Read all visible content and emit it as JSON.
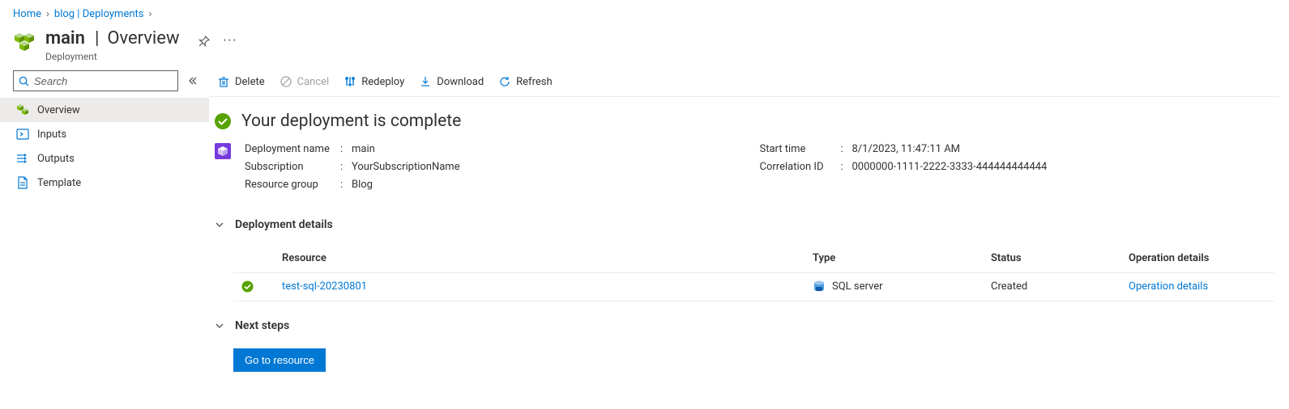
{
  "breadcrumb": {
    "items": [
      "Home",
      "blog | Deployments"
    ]
  },
  "header": {
    "name": "main",
    "section": "Overview",
    "subtitle": "Deployment"
  },
  "sidebar": {
    "search_placeholder": "Search",
    "items": [
      {
        "label": "Overview",
        "icon": "cubes",
        "active": true
      },
      {
        "label": "Inputs",
        "icon": "inputs",
        "active": false
      },
      {
        "label": "Outputs",
        "icon": "outputs",
        "active": false
      },
      {
        "label": "Template",
        "icon": "template",
        "active": false
      }
    ]
  },
  "toolbar": {
    "delete": "Delete",
    "cancel": "Cancel",
    "redeploy": "Redeploy",
    "download": "Download",
    "refresh": "Refresh"
  },
  "status": {
    "title": "Your deployment is complete"
  },
  "meta": {
    "left": {
      "deployment_name_label": "Deployment name",
      "deployment_name_value": "main",
      "subscription_label": "Subscription",
      "subscription_value": "YourSubscriptionName",
      "resource_group_label": "Resource group",
      "resource_group_value": "Blog"
    },
    "right": {
      "start_time_label": "Start time",
      "start_time_value": "8/1/2023, 11:47:11 AM",
      "correlation_label": "Correlation ID",
      "correlation_value": "0000000-1111-2222-3333-444444444444"
    }
  },
  "sections": {
    "details": "Deployment details",
    "next": "Next steps"
  },
  "table": {
    "headers": {
      "resource": "Resource",
      "type": "Type",
      "status": "Status",
      "op": "Operation details"
    },
    "row": {
      "resource": "test-sql-20230801",
      "type": "SQL server",
      "status": "Created",
      "op": "Operation details"
    }
  },
  "buttons": {
    "go": "Go to resource"
  }
}
